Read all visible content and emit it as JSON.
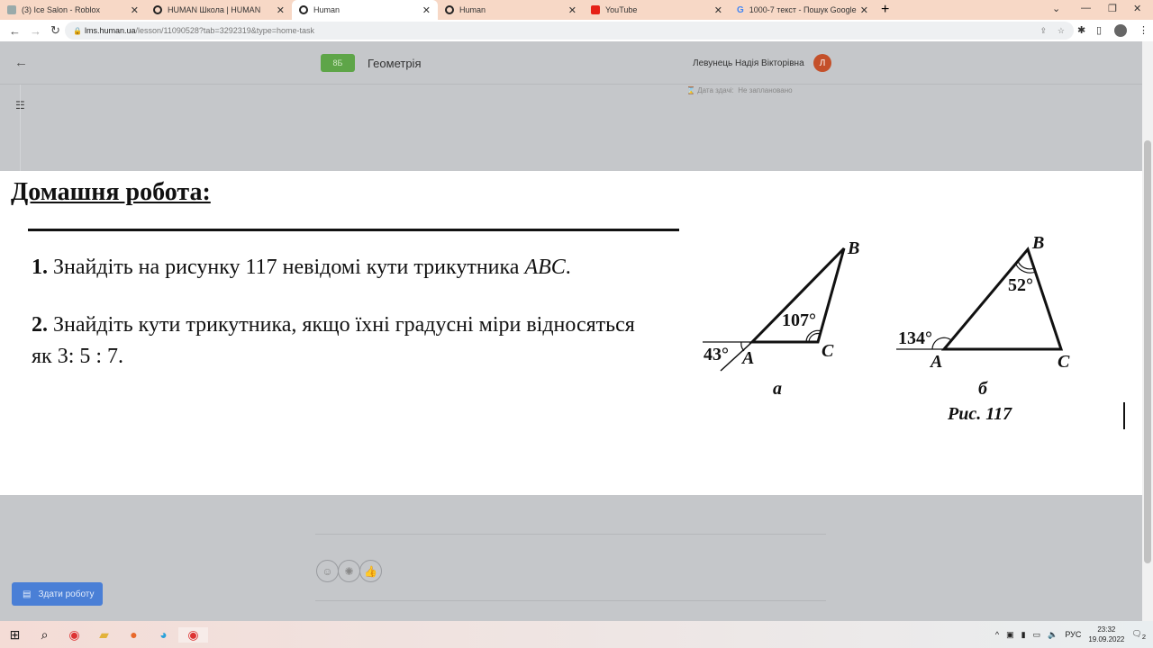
{
  "browser": {
    "tabs": [
      {
        "title": "(3) Ice Salon - Roblox",
        "icon": "roblox-icon"
      },
      {
        "title": "HUMAN Школа | HUMAN",
        "icon": "human-icon"
      },
      {
        "title": "Human",
        "icon": "human-icon",
        "active": true
      },
      {
        "title": "Human",
        "icon": "human-icon"
      },
      {
        "title": "YouTube",
        "icon": "youtube-icon"
      },
      {
        "title": "1000-7 текст - Пошук Google",
        "icon": "google-icon"
      }
    ],
    "url_host": "lms.human.ua",
    "url_path": "/lesson/11090528?tab=3292319&type=home-task"
  },
  "header": {
    "class_badge": "8Б",
    "subject": "Геометрія",
    "teacher": "Левунець Надія Вікторівна",
    "avatar_letter": "Л",
    "due_label": "Дата здачі:",
    "due_value": "Не заплановано"
  },
  "homework": {
    "title": "Домашня робота:",
    "task1_num": "1.",
    "task1_text": " Знайдіть на рисунку 117 невідомі кути трикутника ",
    "task1_abc": "ABC",
    "task1_end": ".",
    "task2_num": "2.",
    "task2_text": " Знайдіть кути трикутника, якщо їхні градусні міри відносяться як 3: 5 : 7.",
    "figure": {
      "caption": "Рис. 117",
      "a": {
        "label": "а",
        "angle_ext_A": "43°",
        "angle_C": "107°",
        "A": "A",
        "B": "B",
        "C": "C"
      },
      "b": {
        "label": "б",
        "angle_ext_A": "134°",
        "angle_B": "52°",
        "A": "A",
        "B": "B",
        "C": "C"
      }
    }
  },
  "actions": {
    "submit": "Здати роботу",
    "reactions": [
      "smile-icon",
      "brain-icon",
      "thumbs-up-icon"
    ]
  },
  "taskbar": {
    "lang": "РУС",
    "time": "23:32",
    "date": "19.09.2022",
    "notifications": "2"
  }
}
